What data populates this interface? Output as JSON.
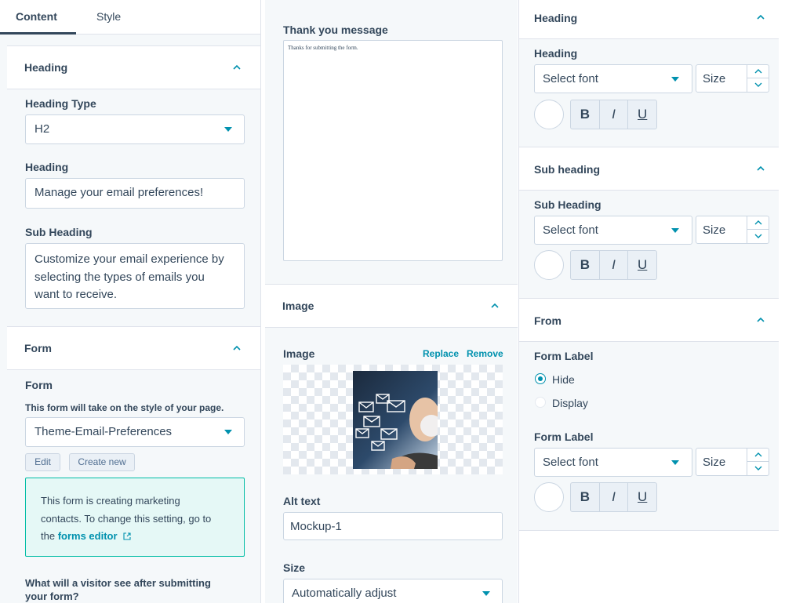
{
  "tabs": {
    "content": "Content",
    "style": "Style"
  },
  "content_panel": {
    "heading_section": {
      "title": "Heading",
      "type_label": "Heading Type",
      "type_value": "H2",
      "heading_label": "Heading",
      "heading_value": "Manage your email preferences!",
      "subheading_label": "Sub Heading",
      "subheading_line1": "Customize your email experience by",
      "subheading_line2": "selecting the types of emails you",
      "subheading_line3": "want to receive."
    },
    "form_section": {
      "title": "Form",
      "form_label": "Form",
      "form_hint": "This form will take on the style of your page.",
      "form_value": "Theme-Email-Preferences",
      "edit_label": "Edit",
      "create_label": "Create new",
      "notice_line1": "This form is creating marketing",
      "notice_line2": "contacts. To change this setting, go to",
      "notice_prefix": "the",
      "notice_link": "forms editor",
      "after_submit_line1": "What will a visitor see after submitting",
      "after_submit_line2": "your form?"
    }
  },
  "middle_panel": {
    "thank_you_label": "Thank you message",
    "thank_you_value": "Thanks for submitting the form.",
    "image_section": {
      "title": "Image",
      "image_label": "Image",
      "replace_label": "Replace",
      "remove_label": "Remove",
      "alt_label": "Alt text",
      "alt_value": "Mockup-1",
      "size_label": "Size",
      "size_value": "Automatically adjust"
    }
  },
  "style_panel": {
    "heading_section": {
      "title": "Heading",
      "label": "Heading",
      "font_placeholder": "Select font",
      "size_placeholder": "Size"
    },
    "subheading_section": {
      "title": "Sub heading",
      "label": "Sub Heading",
      "font_placeholder": "Select font",
      "size_placeholder": "Size"
    },
    "from_section": {
      "title": "From",
      "form_label_title": "Form Label",
      "hide_label": "Hide",
      "display_label": "Display",
      "form_label_font_title": "Form Label",
      "font_placeholder": "Select font",
      "size_placeholder": "Size"
    },
    "format_buttons": {
      "bold": "B",
      "italic": "I",
      "underline": "U"
    }
  },
  "colors": {
    "accent": "#0091ae",
    "text": "#33475b",
    "border": "#cbd6e2",
    "panel_bg": "#f5f8fa",
    "notice_bg": "#e5f8f6",
    "notice_border": "#00bda5"
  }
}
